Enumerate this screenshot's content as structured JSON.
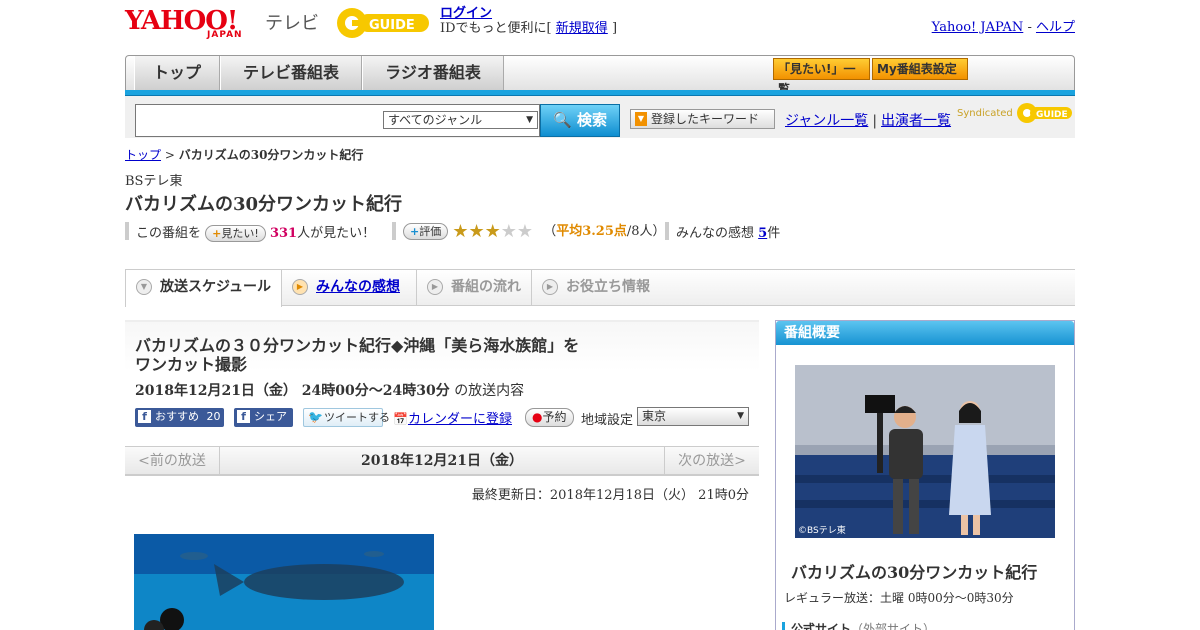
{
  "header": {
    "logo_text": "YAHOO!",
    "logo_sub": "JAPAN",
    "tv_label": "テレビ",
    "login_label": "ログイン",
    "login_note_prefix": "IDでもっと便利に[",
    "register_label": "新規取得",
    "login_note_suffix": "]",
    "yahoo_japan_link": "Yahoo! JAPAN",
    "help_link": "ヘルプ",
    "link_separator": "-"
  },
  "nav": {
    "tabs": [
      {
        "label": "トップ"
      },
      {
        "label": "テレビ番組表"
      },
      {
        "label": "ラジオ番組表"
      }
    ],
    "mitai_list_label": "「見たい!」一覧",
    "my_schedule_label": "My番組表設定"
  },
  "search": {
    "input_value": "",
    "genre_selected": "すべてのジャンル",
    "search_button": "検索",
    "keyword_button": "登録したキーワード",
    "genre_list_link": "ジャンル一覧",
    "cast_list_link": "出演者一覧",
    "syndicated": "Syndicated"
  },
  "breadcrumb": {
    "top": "トップ",
    "separator": ">",
    "current": "バカリズムの30分ワンカット紀行"
  },
  "program": {
    "channel": "BSテレ東",
    "title": "バカリズムの30分ワンカット紀行",
    "mitai_prefix": "この番組を",
    "mitai_button": "見たい!",
    "mitai_count": "331",
    "mitai_suffix": "人が見たい！",
    "rating_button": "評価",
    "rating_value": 3.25,
    "rating_paren_open": "（",
    "rating_avg": "平均3.25点",
    "rating_people": "/8人）",
    "reviews_prefix": "みんなの感想",
    "reviews_count": "5",
    "reviews_suffix": "件"
  },
  "content_tabs": [
    {
      "label": "放送スケジュール"
    },
    {
      "label": "みんなの感想"
    },
    {
      "label": "番組の流れ"
    },
    {
      "label": "お役立ち情報"
    }
  ],
  "episode": {
    "title_line1": "バカリズムの３０分ワンカット紀行◆沖縄「美ら海水族館」を",
    "title_line2": "ワンカット撮影",
    "date_time": "2018年12月21日（金）  24時00分～24時30分",
    "date_suffix": "の放送内容",
    "fb_recommend": "おすすめ",
    "fb_count": "20",
    "fb_share": "シェア",
    "tweet": "ツイートする",
    "calendar": "カレンダーに登録",
    "reserve": "予約",
    "region_label": "地域設定",
    "region_value": "東京"
  },
  "date_nav": {
    "prev": "<前の放送",
    "current": "2018年12月21日（金）",
    "next": "次の放送>"
  },
  "updated": "最終更新日：2018年12月18日（火）  21時0分",
  "sidebar": {
    "heading": "番組概要",
    "photo_credit": "©BSテレ東",
    "title": "バカリズムの30分ワンカット紀行",
    "regular": "レギュラー放送：土曜 0時00分～0時30分",
    "official_label": "公式サイト",
    "official_note": "（外部サイト）"
  },
  "colors": {
    "accent_blue": "#1aa3df",
    "yahoo_red": "#e60012",
    "mitai_pink": "#d10061",
    "star_gold": "#c99a1a"
  }
}
